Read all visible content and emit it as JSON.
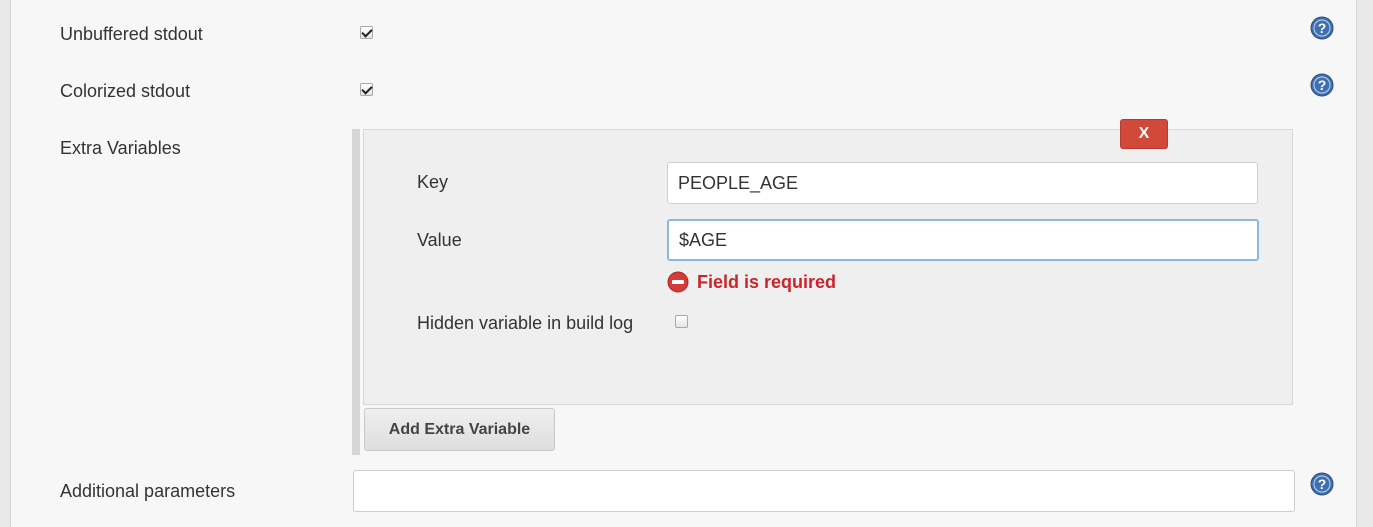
{
  "options": {
    "unbuffered_label": "Unbuffered stdout",
    "unbuffered_checked": true,
    "colorized_label": "Colorized stdout",
    "colorized_checked": true
  },
  "extra_variables": {
    "section_label": "Extra Variables",
    "delete_label": "X",
    "key_label": "Key",
    "key_value": "PEOPLE_AGE",
    "value_label": "Value",
    "value_value": "$AGE",
    "error_message": "Field is required",
    "hidden_label": "Hidden variable in build log",
    "hidden_checked": false,
    "add_button_label": "Add Extra Variable"
  },
  "additional": {
    "label": "Additional parameters",
    "value": ""
  },
  "icons": {
    "help": "help-icon",
    "error": "error-icon"
  },
  "colors": {
    "delete_button": "#d24939",
    "error_text": "#c8262b",
    "help_icon": "#3e6fb0",
    "focus_border": "#8fb7e6"
  }
}
